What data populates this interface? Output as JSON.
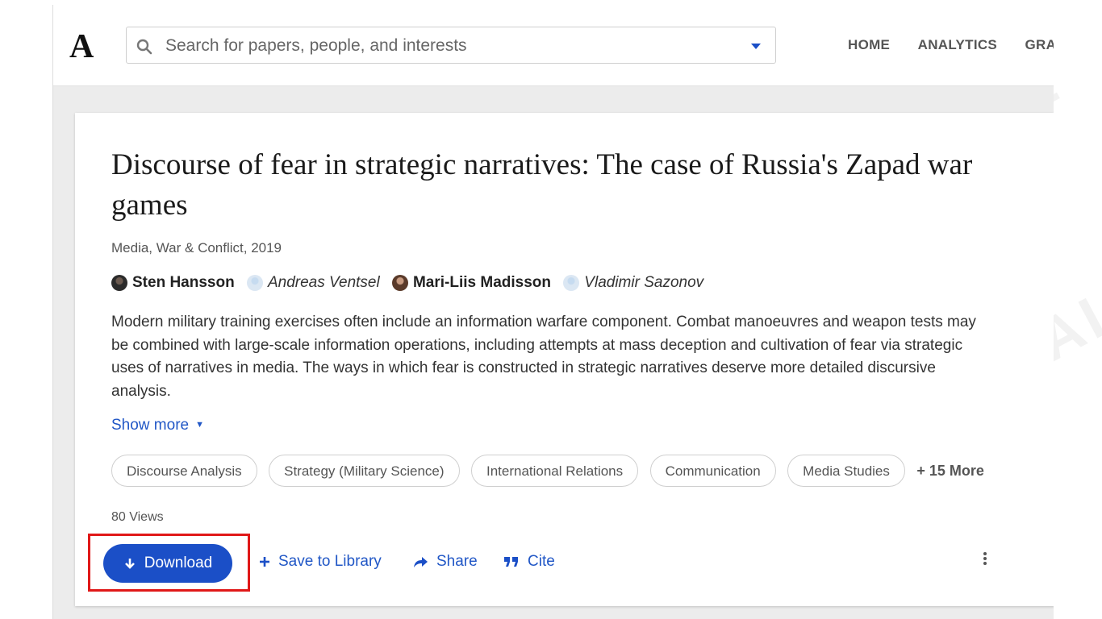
{
  "header": {
    "logo": "A",
    "search": {
      "placeholder": "Search for papers, people, and interests"
    },
    "nav": [
      "HOME",
      "ANALYTICS",
      "GRANT"
    ]
  },
  "paper": {
    "title": "Discourse of fear in strategic narratives: The case of Russia's Zapad war games",
    "venue": "Media, War & Conflict, 2019",
    "authors": [
      {
        "name": "Sten Hansson"
      },
      {
        "name": "Andreas Ventsel"
      },
      {
        "name": "Mari-Liis Madisson"
      },
      {
        "name": "Vladimir Sazonov"
      }
    ],
    "abstract": "Modern military training exercises often include an information warfare component. Combat manoeuvres and weapon tests may be combined with large-scale information operations, including attempts at mass deception and cultivation of fear via strategic uses of narratives in media. The ways in which fear is constructed in strategic narratives deserve more detailed discursive analysis.",
    "show_more": "Show more",
    "tags": [
      "Discourse Analysis",
      "Strategy (Military Science)",
      "International Relations",
      "Communication",
      "Media Studies"
    ],
    "more_tags": "+ 15 More",
    "views": "80 Views"
  },
  "actions": {
    "download": "Download",
    "save": "Save to Library",
    "share": "Share",
    "cite": "Cite"
  },
  "watermark": "BER KAL",
  "colors": {
    "accent": "#1b4fc7",
    "link": "#2157c6",
    "highlight": "#e01818"
  }
}
